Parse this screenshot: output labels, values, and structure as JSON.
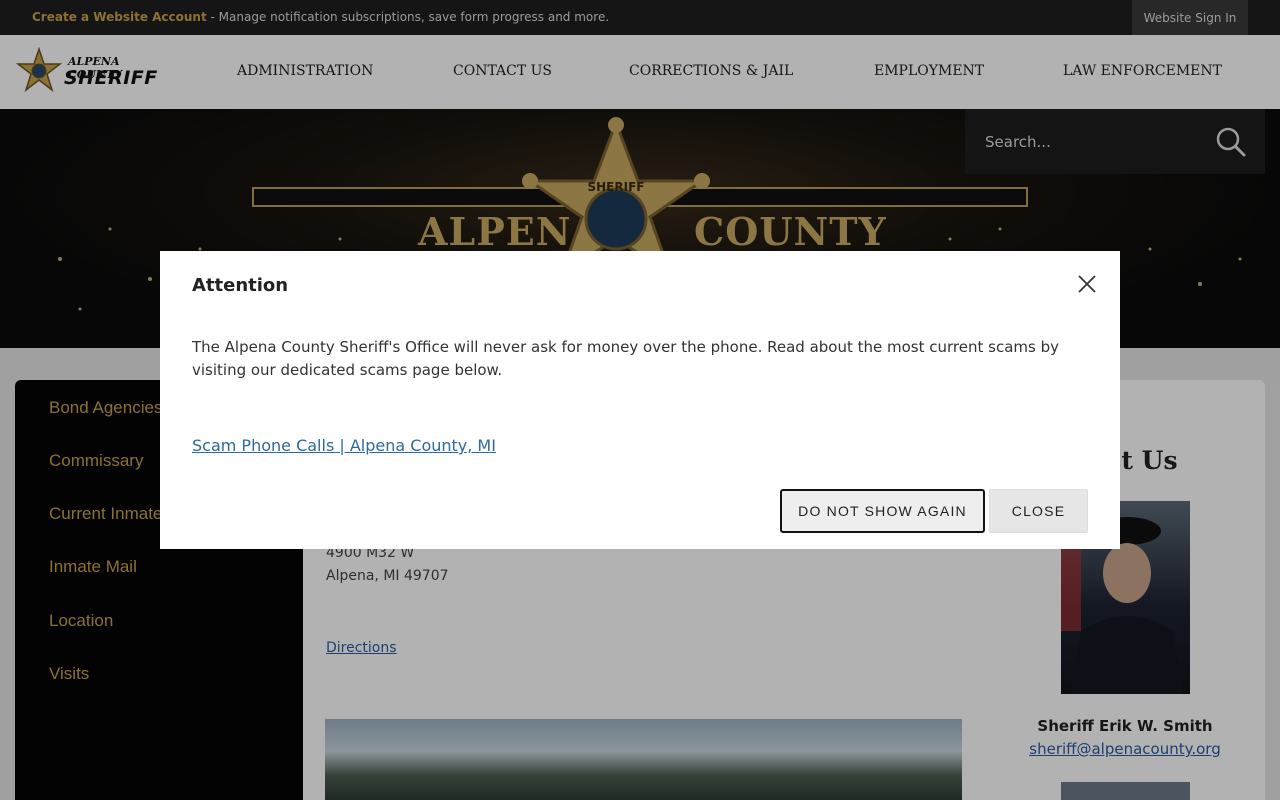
{
  "topbar": {
    "account_link": "Create a Website Account",
    "message": " - Manage notification subscriptions, save form progress and more.",
    "signin": "Website Sign In"
  },
  "logo": {
    "line1": "ALPENA COUNTY",
    "line2": "SHERIFF",
    "icon": "sheriff-star-badge"
  },
  "nav": {
    "items": [
      "ADMINISTRATION",
      "CONTACT US",
      "CORRECTIONS & JAIL",
      "EMPLOYMENT",
      "LAW ENFORCEMENT"
    ]
  },
  "hero": {
    "left_word": "ALPENA",
    "right_word": "COUNTY",
    "badge_text": "SHERIFF"
  },
  "search": {
    "placeholder": "Search...",
    "icon": "search-icon"
  },
  "sidebar": {
    "items": [
      "Bond Agencies",
      "Commissary",
      "Current Inmates",
      "Inmate Mail",
      "Location",
      "Visits"
    ]
  },
  "main": {
    "address_line1": "4900 M32 W",
    "address_line2": "Alpena, MI 49707",
    "directions": "Directions"
  },
  "contact": {
    "heading": "act Us",
    "name": "Sheriff Erik W. Smith",
    "email": "sheriff@alpenacounty.org"
  },
  "modal": {
    "title": "Attention",
    "body": "The Alpena County Sheriff's Office will never ask for money over the phone. Read about the most current scams by visiting our dedicated scams page below.",
    "link": "Scam Phone Calls | Alpena County, MI",
    "do_not_show": "DO NOT SHOW AGAIN",
    "close": "CLOSE"
  },
  "colors": {
    "gold": "#c9a24a",
    "dark": "#1f1f1f",
    "link": "#2c6aa0"
  }
}
